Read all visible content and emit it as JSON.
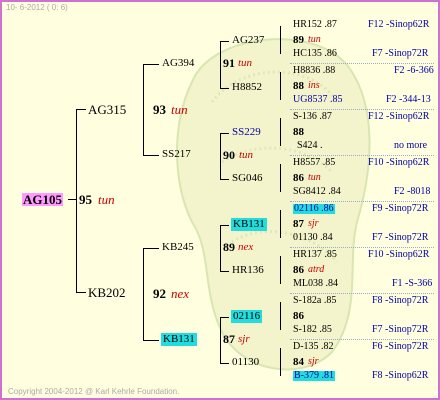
{
  "header": {
    "date": "10- 6-2012 ( 0: 6)"
  },
  "footer": {
    "copyright": "Copyright 2004-2012 @ Karl Kehrle Foundation."
  },
  "subject": {
    "name": "AG105",
    "year": "95",
    "race": "tun"
  },
  "g1": [
    {
      "name": "AG315",
      "year": "93",
      "race": "tun"
    },
    {
      "name": "KB202",
      "year": "92",
      "race": "nex"
    }
  ],
  "g2": [
    {
      "name": "AG394",
      "year": "91",
      "race": "tun"
    },
    {
      "name": "SS217",
      "year": "90",
      "race": "tun"
    },
    {
      "name": "KB245",
      "year": "89",
      "race": "nex"
    },
    {
      "name": "KB131",
      "year": "87",
      "race": "sjr"
    }
  ],
  "g3": [
    {
      "name": "AG237"
    },
    {
      "name": "H8852"
    },
    {
      "name": "SS229"
    },
    {
      "name": "SG046"
    },
    {
      "name": "KB131"
    },
    {
      "name": "HR136"
    },
    {
      "name": "02116"
    },
    {
      "name": "01130"
    }
  ],
  "g4": [
    {
      "top": "HR152 .87",
      "mid_year": "89",
      "mid_race": "tun",
      "bot": "HC135 .86",
      "top_r": "F12 -Sinop62R",
      "bot_r": "F7 -Sinop72R"
    },
    {
      "top": "H8836 .88",
      "mid_year": "88",
      "mid_race": "ins",
      "bot": "UG8537 .85",
      "top_r": "F2 -6-366",
      "bot_r": "F2 -344-13"
    },
    {
      "top": "S-136 .87",
      "mid_year": "88",
      "mid_race": "",
      "bot": "S424 .",
      "top_r": "F12 -Sinop62R",
      "bot_r": "no more"
    },
    {
      "top": "H8557 .85",
      "mid_year": "86",
      "mid_race": "tun",
      "bot": "SG8412 .84",
      "top_r": "F10 -Sinop62R",
      "bot_r": "F2 -8018"
    },
    {
      "top": "02116 .86",
      "mid_year": "87",
      "mid_race": "sjr",
      "bot": "01130 .84",
      "top_r": "F9 -Sinop72R",
      "bot_r": "F7 -Sinop72R"
    },
    {
      "top": "HR137 .85",
      "mid_year": "86",
      "mid_race": "atrd",
      "bot": "ML038 .84",
      "top_r": "F10 -Sinop62R",
      "bot_r": "F1 -S-366"
    },
    {
      "top": "S-182a .85",
      "mid_year": "86",
      "mid_race": "",
      "bot": "S-182 .85",
      "top_r": "F8 -Sinop72R",
      "bot_r": "F7 -Sinop72R"
    },
    {
      "top": "D-135 .82",
      "mid_year": "84",
      "mid_race": "sjr",
      "bot": "B-379 .81",
      "top_r": "F6 -Sinop72R",
      "bot_r": "F8 -Sinop62R"
    }
  ]
}
